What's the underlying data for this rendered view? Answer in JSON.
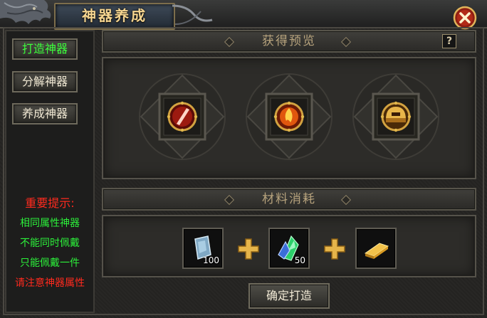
{
  "window": {
    "title": "神器养成"
  },
  "sidebar": {
    "items": [
      {
        "label": "打造神器",
        "active": true
      },
      {
        "label": "分解神器",
        "active": false
      },
      {
        "label": "养成神器",
        "active": false
      }
    ]
  },
  "tips": {
    "heading": "重要提示:",
    "lines": [
      "相同属性神器",
      "不能同时佩戴",
      "只能佩戴一件"
    ],
    "warning": "请注意神器属性"
  },
  "preview": {
    "header": "获得预览",
    "help_label": "?",
    "items": [
      {
        "icon": "red-blade-artifact-icon"
      },
      {
        "icon": "fire-orb-artifact-icon"
      },
      {
        "icon": "golden-helm-artifact-icon"
      }
    ]
  },
  "materials": {
    "header": "材料消耗",
    "items": [
      {
        "icon": "blue-stone-icon",
        "count": "100"
      },
      {
        "icon": "green-crystal-icon",
        "count": "50"
      },
      {
        "icon": "gold-bar-icon",
        "count": ""
      }
    ]
  },
  "actions": {
    "confirm_label": "确定打造"
  },
  "colors": {
    "title_gold": "#f5d590",
    "active_green": "#3cff3c",
    "tip_red": "#ff2a1e",
    "tip_green": "#2cf03a",
    "plus_gold": "#e6b54a"
  }
}
